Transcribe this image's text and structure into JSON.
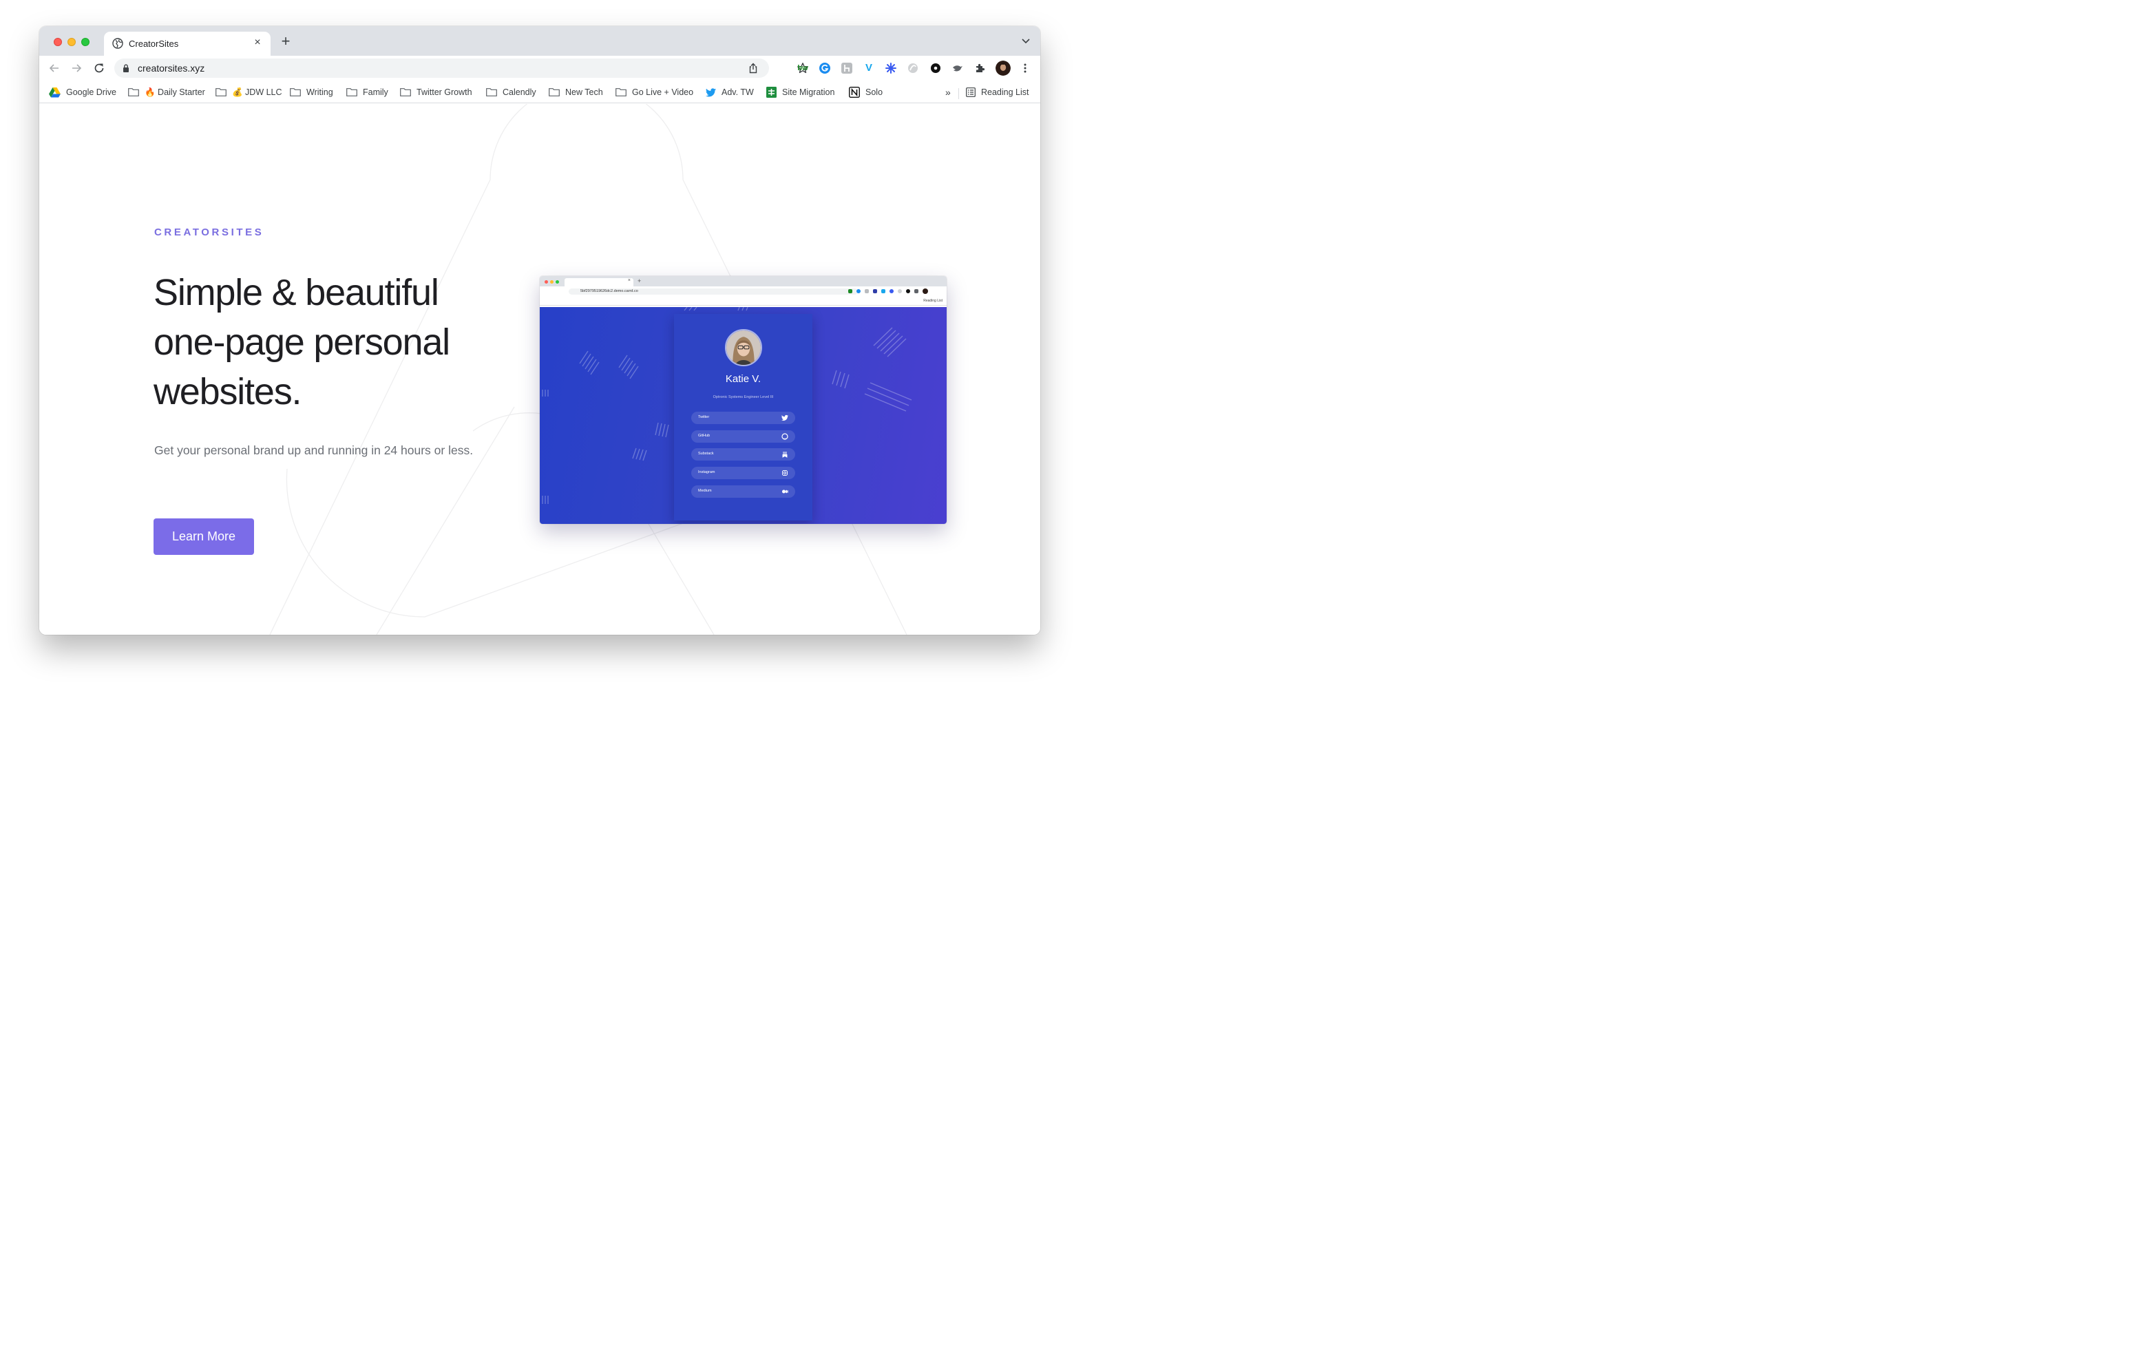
{
  "browser": {
    "tab_title": "CreatorSites",
    "new_tab": "+",
    "tab_close": "×",
    "url": "creatorsites.xyz",
    "extensions": [
      "bw",
      "grammarly-icon",
      "h-icon",
      "V",
      "asterisk-icon",
      "swirl-icon",
      "dot-icon",
      "bird-icon",
      "puzzle-icon",
      "avatar"
    ],
    "bookmarks": [
      {
        "label": "Google Drive",
        "icon": "google-drive-icon"
      },
      {
        "label": "🔥 Daily Starter",
        "icon": "folder-icon"
      },
      {
        "label": "💰 JDW LLC",
        "icon": "folder-icon"
      },
      {
        "label": "Writing",
        "icon": "folder-icon"
      },
      {
        "label": "Family",
        "icon": "folder-icon"
      },
      {
        "label": "Twitter Growth",
        "icon": "folder-icon"
      },
      {
        "label": "Calendly",
        "icon": "folder-icon"
      },
      {
        "label": "New Tech",
        "icon": "folder-icon"
      },
      {
        "label": "Go Live + Video",
        "icon": "folder-icon"
      },
      {
        "label": "Adv. TW",
        "icon": "twitter-icon"
      },
      {
        "label": "Site Migration",
        "icon": "sheets-icon"
      },
      {
        "label": "Solo",
        "icon": "notion-icon"
      }
    ],
    "bookmarks_overflow": "»",
    "reading_list": "Reading List"
  },
  "hero": {
    "eyebrow": "CREATORSITES",
    "headline_line1": "Simple & beautiful",
    "headline_line2": "one-page personal",
    "headline_line3": "websites.",
    "subtext": "Get your personal brand up and running in 24 hours or less.",
    "cta": "Learn More",
    "accent_color": "#7b6ce8"
  },
  "mockup": {
    "url": "5bf2979519626dc2.demo.carrd.co",
    "tab_close": "×",
    "new_tab": "+",
    "reading_list": "Reading List",
    "name": "Katie V.",
    "role": "Optronic Systems Engineer Level III",
    "links": [
      {
        "label": "Twitter",
        "icon": "twitter-icon"
      },
      {
        "label": "GitHub",
        "icon": "github-icon"
      },
      {
        "label": "Substack",
        "icon": "substack-icon"
      },
      {
        "label": "Instagram",
        "icon": "instagram-icon"
      },
      {
        "label": "Medium",
        "icon": "medium-icon"
      }
    ]
  }
}
